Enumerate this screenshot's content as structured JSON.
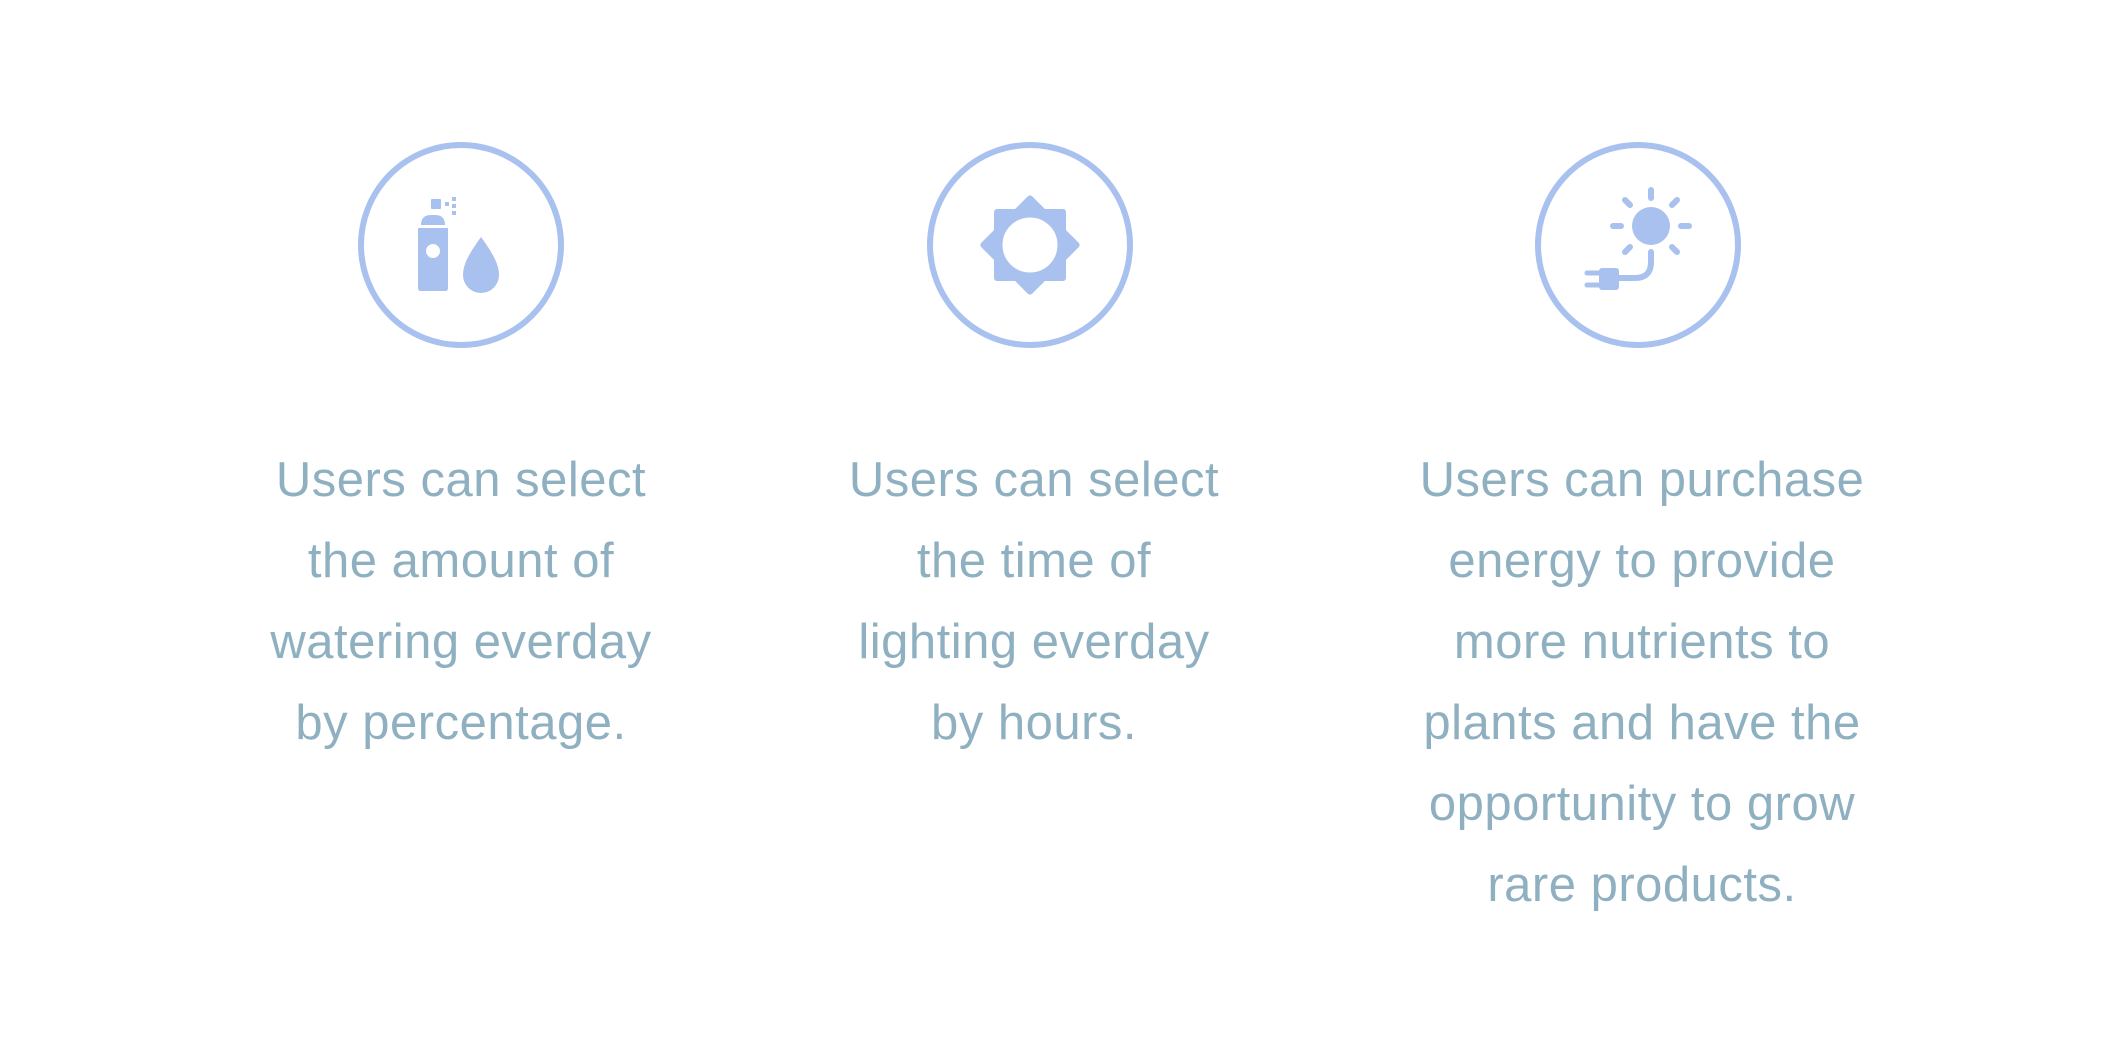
{
  "features": [
    {
      "icon": "watering-icon",
      "lines": [
        "Users can select",
        "the amount of",
        "watering everday",
        "by percentage."
      ]
    },
    {
      "icon": "brightness-icon",
      "lines": [
        "Users can select",
        "the time of",
        "lighting everday",
        "by hours."
      ]
    },
    {
      "icon": "solar-energy-icon",
      "lines": [
        "Users can purchase",
        "energy to provide",
        "more nutrients to",
        "plants and have the",
        "opportunity to grow",
        "rare products."
      ]
    }
  ],
  "colors": {
    "icon": "#a9c1ee",
    "text": "#8fb0c1",
    "background": "#ffffff"
  }
}
